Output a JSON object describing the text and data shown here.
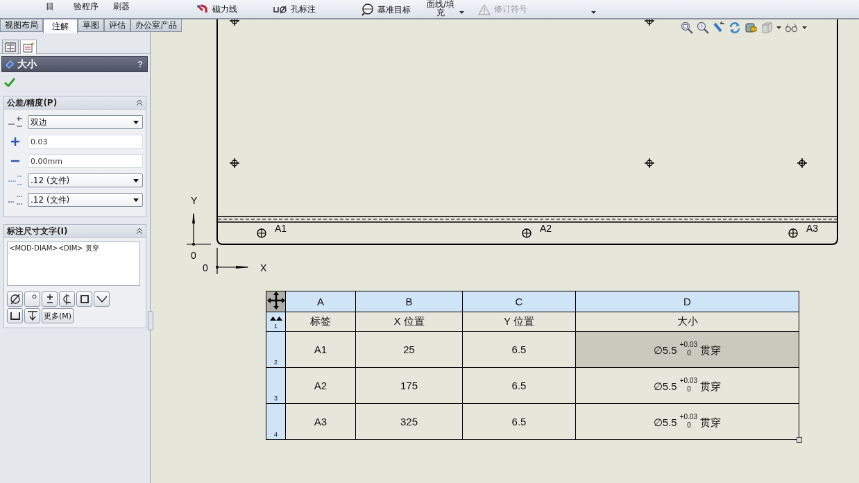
{
  "toolbar": {
    "items": [
      {
        "label": "目",
        "kind": "text",
        "disabled": false
      },
      {
        "label": "验程序",
        "kind": "text",
        "disabled": false
      },
      {
        "label": "刷器",
        "kind": "text",
        "disabled": false
      },
      {
        "label": "磁力线",
        "kind": "magnet",
        "disabled": false
      },
      {
        "label": "孔标注",
        "kind": "hole",
        "disabled": false
      },
      {
        "label": "基准目标",
        "kind": "datum",
        "disabled": false
      },
      {
        "label": "面线/填充",
        "kind": "wrapped",
        "disabled": false
      },
      {
        "label": "修订符号",
        "kind": "revision",
        "disabled": true
      }
    ]
  },
  "command_tabs": [
    {
      "label": "视图布局",
      "selected": false
    },
    {
      "label": "注解",
      "selected": true
    },
    {
      "label": "草图",
      "selected": false
    },
    {
      "label": "评估",
      "selected": false
    },
    {
      "label": "办公室产品",
      "selected": false
    }
  ],
  "panel_tabs": [
    {
      "kind": "tree",
      "selected": false
    },
    {
      "kind": "properties",
      "selected": true
    }
  ],
  "property_manager": {
    "title": "大小",
    "help": "?",
    "tolerance_group": {
      "title": "公差/精度(P)",
      "expanded": true,
      "rows": [
        {
          "kind": "type-select",
          "value": "双边"
        },
        {
          "kind": "plus-field",
          "value": "0.03"
        },
        {
          "kind": "minus-field",
          "value": "0.00mm"
        },
        {
          "kind": "precision-select",
          "value": ".12 (文件)"
        },
        {
          "kind": "tolerance-precision-select",
          "value": ".12 (文件)"
        }
      ]
    },
    "text_group": {
      "title": "标注尺寸文字(I)",
      "expanded": true,
      "text": "<MOD-DIAM><DIM> 贯穿",
      "symbol_buttons": [
        {
          "kind": "diameter"
        },
        {
          "kind": "degree"
        },
        {
          "kind": "plusminus"
        },
        {
          "kind": "centerline"
        },
        {
          "kind": "square"
        },
        {
          "kind": "countersink"
        },
        {
          "kind": "counterbore"
        },
        {
          "kind": "depth"
        }
      ],
      "more_button": "更多(M)"
    }
  },
  "drawing": {
    "hole_labels": [
      "A1",
      "A2",
      "A3"
    ],
    "y_axis": {
      "label": "Y",
      "origin": "0"
    },
    "x_axis": {
      "label": "X",
      "origin": "0"
    }
  },
  "table": {
    "columns": [
      "A",
      "B",
      "C",
      "D"
    ],
    "rows": [
      {
        "number": "1",
        "cells": [
          {
            "text": "标签",
            "selected": false
          },
          {
            "text": "X 位置",
            "selected": false
          },
          {
            "text": "Y 位置",
            "selected": false
          },
          {
            "text": "大小",
            "selected": false
          }
        ]
      },
      {
        "number": "2",
        "cells": [
          {
            "text": "A1",
            "selected": false
          },
          {
            "text": "25",
            "selected": false
          },
          {
            "text": "6.5",
            "selected": false
          },
          {
            "text": "∅5.5 $^{+0.03}$$_{0}$ 贯穿",
            "selected": true
          }
        ]
      },
      {
        "number": "3",
        "cells": [
          {
            "text": "A2",
            "selected": false
          },
          {
            "text": "175",
            "selected": false
          },
          {
            "text": "6.5",
            "selected": false
          },
          {
            "text": "∅5.5 $^{+0.03}$$_{0}$ 贯穿",
            "selected": false
          }
        ]
      },
      {
        "number": "4",
        "cells": [
          {
            "text": "A3",
            "selected": false
          },
          {
            "text": "325",
            "selected": false
          },
          {
            "text": "6.5",
            "selected": false
          },
          {
            "text": "∅5.5 $^{+0.03}$$_{0}$ 贯穿",
            "selected": false
          }
        ]
      }
    ]
  }
}
